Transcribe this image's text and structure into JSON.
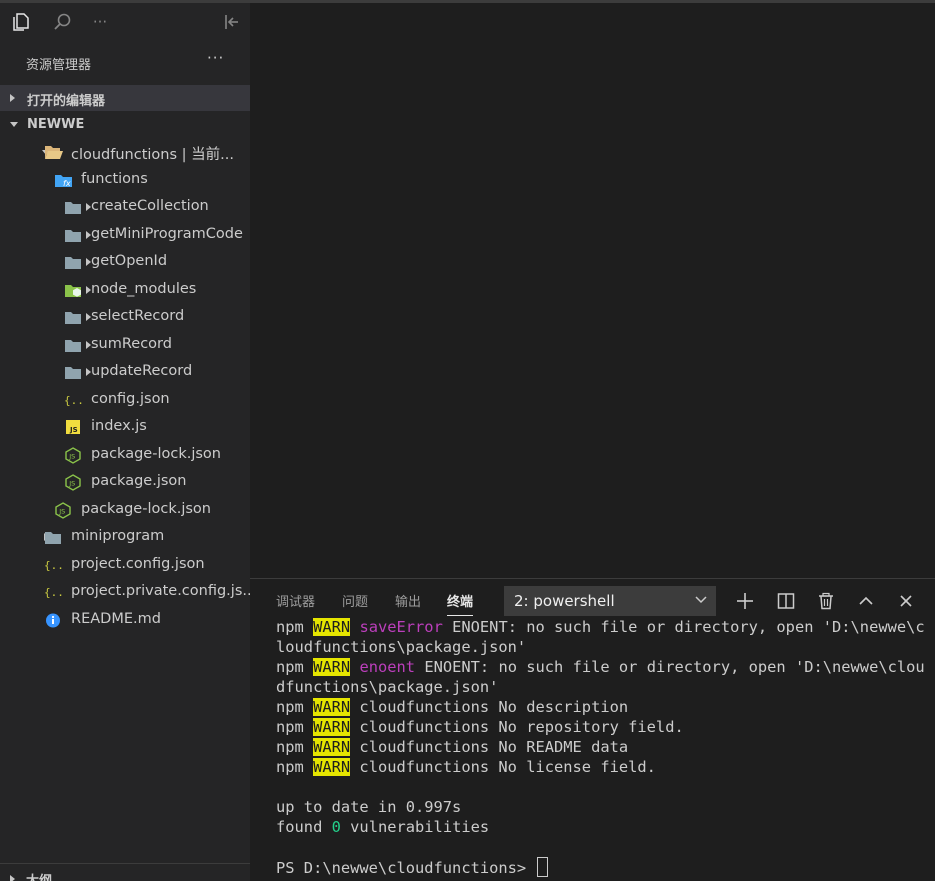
{
  "sidebar": {
    "header_title": "资源管理器",
    "more_label": "···",
    "open_editors_label": "打开的编辑器",
    "workspace_label": "NEWWE",
    "outline_label": "大纲"
  },
  "tree": [
    {
      "label": "cloudfunctions | 当前...",
      "depth": 1,
      "expanded": true,
      "kind": "folder-open"
    },
    {
      "label": "functions",
      "depth": 2,
      "expanded": true,
      "kind": "folder-fx"
    },
    {
      "label": "createCollection",
      "depth": 3,
      "expanded": false,
      "kind": "folder"
    },
    {
      "label": "getMiniProgramCode",
      "depth": 3,
      "expanded": false,
      "kind": "folder"
    },
    {
      "label": "getOpenId",
      "depth": 3,
      "expanded": false,
      "kind": "folder"
    },
    {
      "label": "node_modules",
      "depth": 3,
      "expanded": false,
      "kind": "folder-node"
    },
    {
      "label": "selectRecord",
      "depth": 3,
      "expanded": false,
      "kind": "folder"
    },
    {
      "label": "sumRecord",
      "depth": 3,
      "expanded": false,
      "kind": "folder"
    },
    {
      "label": "updateRecord",
      "depth": 3,
      "expanded": false,
      "kind": "folder"
    },
    {
      "label": "config.json",
      "depth": 3,
      "kind": "json"
    },
    {
      "label": "index.js",
      "depth": 3,
      "kind": "js"
    },
    {
      "label": "package-lock.json",
      "depth": 3,
      "kind": "node"
    },
    {
      "label": "package.json",
      "depth": 3,
      "kind": "node"
    },
    {
      "label": "package-lock.json",
      "depth": 2,
      "kind": "node"
    },
    {
      "label": "miniprogram",
      "depth": 1,
      "expanded": false,
      "kind": "folder"
    },
    {
      "label": "project.config.json",
      "depth": 1,
      "kind": "json"
    },
    {
      "label": "project.private.config.js...",
      "depth": 1,
      "kind": "json"
    },
    {
      "label": "README.md",
      "depth": 1,
      "kind": "info"
    }
  ],
  "panel": {
    "tabs": [
      "调试器",
      "问题",
      "输出",
      "终端"
    ],
    "active_tab": 3,
    "terminal_select": "2: powershell"
  },
  "terminal": {
    "npm": "npm",
    "warn": "WARN",
    "lines": [
      {
        "pre": "npm ",
        "tag": "WARN",
        "mid": "saveError",
        "post": " ENOENT: no such file or directory, open 'D:\\newwe\\c"
      },
      {
        "text": "loudfunctions\\package.json'"
      },
      {
        "pre": "npm ",
        "tag": "WARN",
        "mid": "enoent",
        "post": " ENOENT: no such file or directory, open 'D:\\newwe\\clou"
      },
      {
        "text": "dfunctions\\package.json'"
      },
      {
        "pre": "npm ",
        "tag": "WARN",
        "post": " cloudfunctions No description"
      },
      {
        "pre": "npm ",
        "tag": "WARN",
        "post": " cloudfunctions No repository field."
      },
      {
        "pre": "npm ",
        "tag": "WARN",
        "post": " cloudfunctions No README data"
      },
      {
        "pre": "npm ",
        "tag": "WARN",
        "post": " cloudfunctions No license field."
      },
      {
        "text": ""
      },
      {
        "text": "up to date in 0.997s"
      },
      {
        "pre": "found ",
        "num": "0",
        "post": " vulnerabilities"
      },
      {
        "text": ""
      },
      {
        "text": "PS D:\\newwe\\cloudfunctions> ",
        "cursor": true
      }
    ]
  },
  "colors": {
    "sidebar_bg": "#252526",
    "editor_bg": "#1e1e1e",
    "warn_bg": "#e5e500",
    "magenta": "#bc3fbc",
    "green": "#23d18b",
    "folder": "#90a4ae",
    "json_icon": "#cbcb41",
    "js_icon": "#f1dd3f",
    "node_icon": "#8bc34a",
    "info_icon": "#3794ff"
  }
}
